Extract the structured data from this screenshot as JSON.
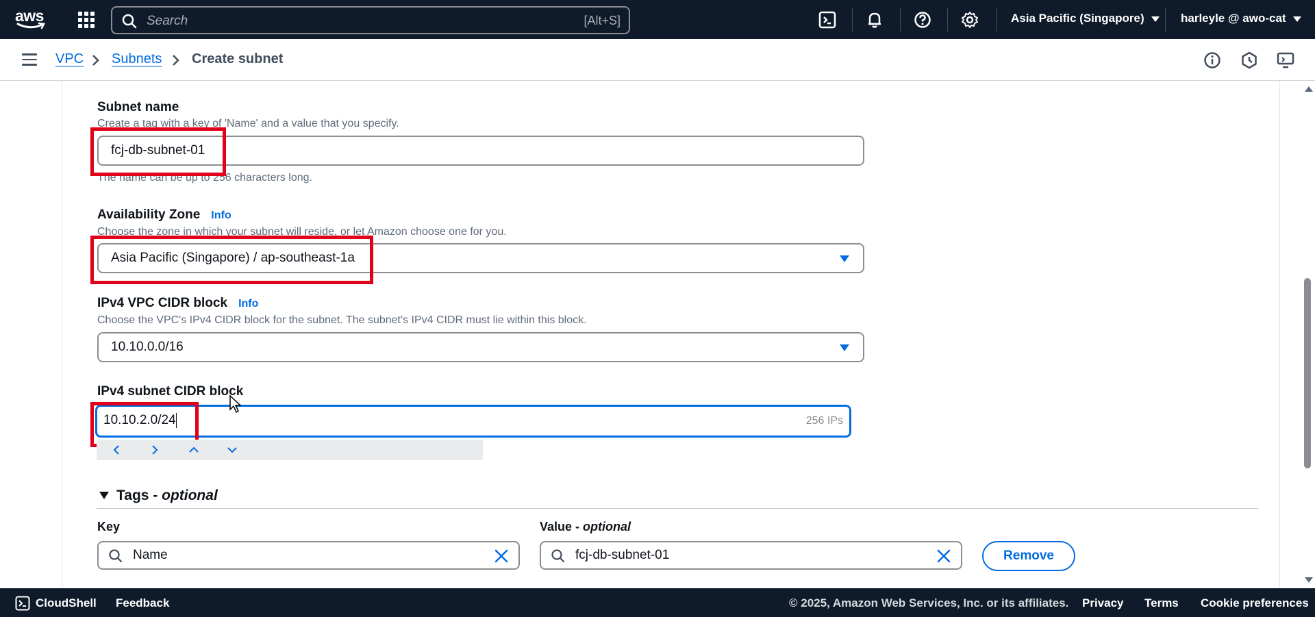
{
  "topbar": {
    "logo_text": "aws",
    "search_placeholder": "Search",
    "search_shortcut": "[Alt+S]",
    "region": "Asia Pacific (Singapore)",
    "user": "harleyle @ awo-cat"
  },
  "breadcrumb": {
    "items": [
      "VPC",
      "Subnets",
      "Create subnet"
    ]
  },
  "form": {
    "subnet_name": {
      "label": "Subnet name",
      "description": "Create a tag with a key of 'Name' and a value that you specify.",
      "value": "fcj-db-subnet-01",
      "hint": "The name can be up to 256 characters long."
    },
    "availability_zone": {
      "label": "Availability Zone",
      "info": "Info",
      "description": "Choose the zone in which your subnet will reside, or let Amazon choose one for you.",
      "value": "Asia Pacific (Singapore) / ap-southeast-1a"
    },
    "vpc_cidr": {
      "label": "IPv4 VPC CIDR block",
      "info": "Info",
      "description": "Choose the VPC's IPv4 CIDR block for the subnet. The subnet's IPv4 CIDR must lie within this block.",
      "value": "10.10.0.0/16"
    },
    "subnet_cidr": {
      "label": "IPv4 subnet CIDR block",
      "value": "10.10.2.0/24",
      "suffix": "256 IPs"
    }
  },
  "tags": {
    "title_prefix": "Tags - ",
    "title_optional": "optional",
    "key_label": "Key",
    "value_label_prefix": "Value - ",
    "value_label_optional": "optional",
    "key_value": "Name",
    "value_value": "fcj-db-subnet-01",
    "remove_label": "Remove"
  },
  "footer": {
    "cloudshell": "CloudShell",
    "feedback": "Feedback",
    "copyright": "© 2025, Amazon Web Services, Inc. or its affiliates.",
    "privacy": "Privacy",
    "terms": "Terms",
    "cookies": "Cookie preferences"
  },
  "colors": {
    "nav_bg": "#0f1b2a",
    "link": "#006ce0",
    "highlight": "#e0001a"
  }
}
